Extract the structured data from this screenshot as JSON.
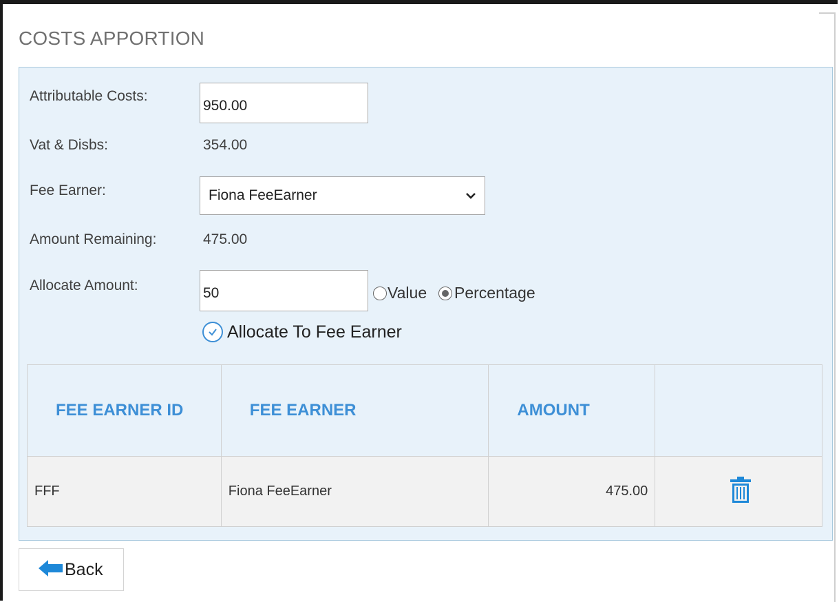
{
  "page": {
    "title": "COSTS APPORTION"
  },
  "form": {
    "attributable_costs": {
      "label": "Attributable Costs:",
      "value": "950.00"
    },
    "vat_disbs": {
      "label": "Vat & Disbs:",
      "value": "354.00"
    },
    "fee_earner": {
      "label": "Fee Earner:",
      "selected": "Fiona FeeEarner"
    },
    "amount_remaining": {
      "label": "Amount Remaining:",
      "value": "475.00"
    },
    "allocate_amount": {
      "label": "Allocate Amount:",
      "value": "50",
      "options": [
        {
          "label": "Value",
          "checked": false
        },
        {
          "label": "Percentage",
          "checked": true
        }
      ]
    },
    "allocate_button": {
      "label": "Allocate To Fee Earner",
      "icon": "check-circle-icon"
    }
  },
  "table": {
    "columns": [
      "FEE EARNER ID",
      "FEE EARNER",
      "AMOUNT",
      ""
    ],
    "rows": [
      {
        "id": "FFF",
        "name": "Fiona FeeEarner",
        "amount": "475.00",
        "action_icon": "trash-icon"
      }
    ]
  },
  "footer": {
    "back_label": "Back",
    "back_icon": "arrow-left-icon"
  },
  "colors": {
    "accent": "#3d8fd6",
    "panel_bg": "#e8f2fa",
    "row_bg": "#f2f2f2"
  }
}
